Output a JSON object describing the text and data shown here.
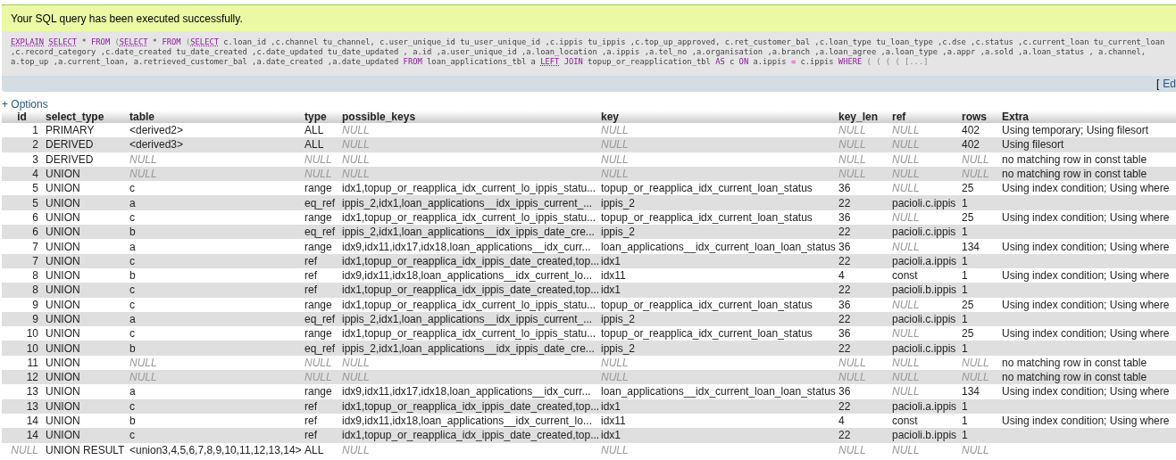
{
  "message": "Your SQL query has been executed successfully.",
  "sql_lines": [
    [
      {
        "kind": "func",
        "text": "EXPLAIN"
      },
      {
        "kind": "func",
        "text": "SELECT"
      },
      {
        "kind": "plain",
        "text": " * "
      },
      {
        "kind": "keyword",
        "text": "FROM"
      },
      {
        "kind": "punct",
        "text": " ("
      },
      {
        "kind": "func",
        "text": "SELECT"
      },
      {
        "kind": "plain",
        "text": " * "
      },
      {
        "kind": "keyword",
        "text": "FROM"
      },
      {
        "kind": "punct",
        "text": " ("
      },
      {
        "kind": "func",
        "text": "SELECT"
      },
      {
        "kind": "plain",
        "text": " c.loan_id ,c.channel tu_channel, c.user_unique_id tu_user_unique_id ,c.ippis tu_ippis ,c.top_up_approved, c.ret_customer_bal ,c.loan_type tu_loan_type ,c.dse ,c.status ,c.current_loan tu_current_loan"
      }
    ],
    [
      {
        "kind": "plain",
        "text": ",c.record_category ,c.date_created tu_date_created ,c.date_updated tu_date_updated , a.id ,a.user_unique_id ,a.loan_location ,a.ippis ,a.tel_no ,a.organisation ,a.branch ,a.loan_agree ,a.loan_type ,a.appr ,a.sold ,a.loan_status , a.channel,"
      }
    ],
    [
      {
        "kind": "plain",
        "text": "a.top_up ,a.current_loan, a.retrieved_customer_bal ,a.date_created ,a.date_updated "
      },
      {
        "kind": "keyword",
        "text": "FROM"
      },
      {
        "kind": "plain",
        "text": " loan_applications_tbl a "
      },
      {
        "kind": "func",
        "text": "LEFT"
      },
      {
        "kind": "keyword",
        "text": "JOIN"
      },
      {
        "kind": "plain",
        "text": " topup_or_reapplication_tbl "
      },
      {
        "kind": "keyword",
        "text": "AS"
      },
      {
        "kind": "plain",
        "text": " c "
      },
      {
        "kind": "keyword",
        "text": "ON"
      },
      {
        "kind": "plain",
        "text": " a.ippis "
      },
      {
        "kind": "operator",
        "text": "="
      },
      {
        "kind": "plain",
        "text": " c.ippis "
      },
      {
        "kind": "keyword",
        "text": "WHERE"
      },
      {
        "kind": "punct",
        "text": " ( ( ( ( [...]"
      }
    ]
  ],
  "edit_bracket": "[",
  "edit_link": "Ed",
  "options_link": "+ Options",
  "table": {
    "columns": [
      "id",
      "select_type",
      "table",
      "type",
      "possible_keys",
      "key",
      "key_len",
      "ref",
      "rows",
      "Extra"
    ],
    "rows": [
      [
        "1",
        "PRIMARY",
        "<derived2>",
        "ALL",
        {
          "kind": "null",
          "text": "NULL"
        },
        {
          "kind": "null",
          "text": "NULL"
        },
        {
          "kind": "null",
          "text": "NULL"
        },
        {
          "kind": "null",
          "text": "NULL"
        },
        "402",
        "Using temporary; Using filesort"
      ],
      [
        "2",
        "DERIVED",
        "<derived3>",
        "ALL",
        {
          "kind": "null",
          "text": "NULL"
        },
        {
          "kind": "null",
          "text": "NULL"
        },
        {
          "kind": "null",
          "text": "NULL"
        },
        {
          "kind": "null",
          "text": "NULL"
        },
        "402",
        "Using filesort"
      ],
      [
        "3",
        "DERIVED",
        {
          "kind": "null",
          "text": "NULL"
        },
        {
          "kind": "null",
          "text": "NULL"
        },
        {
          "kind": "null",
          "text": "NULL"
        },
        {
          "kind": "null",
          "text": "NULL"
        },
        {
          "kind": "null",
          "text": "NULL"
        },
        {
          "kind": "null",
          "text": "NULL"
        },
        {
          "kind": "null",
          "text": "NULL"
        },
        "no matching row in const table"
      ],
      [
        "4",
        "UNION",
        {
          "kind": "null",
          "text": "NULL"
        },
        {
          "kind": "null",
          "text": "NULL"
        },
        {
          "kind": "null",
          "text": "NULL"
        },
        {
          "kind": "null",
          "text": "NULL"
        },
        {
          "kind": "null",
          "text": "NULL"
        },
        {
          "kind": "null",
          "text": "NULL"
        },
        {
          "kind": "null",
          "text": "NULL"
        },
        "no matching row in const table"
      ],
      [
        "5",
        "UNION",
        "c",
        "range",
        "idx1,topup_or_reapplica_idx_current_lo_ippis_statu...",
        "topup_or_reapplica_idx_current_loan_status",
        "36",
        {
          "kind": "null",
          "text": "NULL"
        },
        "25",
        "Using index condition; Using where"
      ],
      [
        "5",
        "UNION",
        "a",
        "eq_ref",
        "ippis_2,idx1,loan_applications__idx_ippis_current_...",
        "ippis_2",
        "22",
        "pacioli.c.ippis",
        "1",
        ""
      ],
      [
        "6",
        "UNION",
        "c",
        "range",
        "idx1,topup_or_reapplica_idx_current_lo_ippis_statu...",
        "topup_or_reapplica_idx_current_loan_status",
        "36",
        {
          "kind": "null",
          "text": "NULL"
        },
        "25",
        "Using index condition; Using where"
      ],
      [
        "6",
        "UNION",
        "b",
        "eq_ref",
        "ippis_2,idx1,loan_applications__idx_ippis_date_cre...",
        "ippis_2",
        "22",
        "pacioli.c.ippis",
        "1",
        ""
      ],
      [
        "7",
        "UNION",
        "a",
        "range",
        "idx9,idx11,idx17,idx18,loan_applications__idx_curr...",
        "loan_applications__idx_current_loan_loan_status",
        "36",
        {
          "kind": "null",
          "text": "NULL"
        },
        "134",
        "Using index condition; Using where"
      ],
      [
        "7",
        "UNION",
        "c",
        "ref",
        "idx1,topup_or_reapplica_idx_ippis_date_created,top...",
        "idx1",
        "22",
        "pacioli.a.ippis",
        "1",
        ""
      ],
      [
        "8",
        "UNION",
        "b",
        "ref",
        "idx9,idx11,idx18,loan_applications__idx_current_lo...",
        "idx11",
        "4",
        "const",
        "1",
        "Using index condition; Using where"
      ],
      [
        "8",
        "UNION",
        "c",
        "ref",
        "idx1,topup_or_reapplica_idx_ippis_date_created,top...",
        "idx1",
        "22",
        "pacioli.b.ippis",
        "1",
        ""
      ],
      [
        "9",
        "UNION",
        "c",
        "range",
        "idx1,topup_or_reapplica_idx_current_lo_ippis_statu...",
        "topup_or_reapplica_idx_current_loan_status",
        "36",
        {
          "kind": "null",
          "text": "NULL"
        },
        "25",
        "Using index condition; Using where"
      ],
      [
        "9",
        "UNION",
        "a",
        "eq_ref",
        "ippis_2,idx1,loan_applications__idx_ippis_current_...",
        "ippis_2",
        "22",
        "pacioli.c.ippis",
        "1",
        ""
      ],
      [
        "10",
        "UNION",
        "c",
        "range",
        "idx1,topup_or_reapplica_idx_current_lo_ippis_statu...",
        "topup_or_reapplica_idx_current_loan_status",
        "36",
        {
          "kind": "null",
          "text": "NULL"
        },
        "25",
        "Using index condition; Using where"
      ],
      [
        "10",
        "UNION",
        "b",
        "eq_ref",
        "ippis_2,idx1,loan_applications__idx_ippis_date_cre...",
        "ippis_2",
        "22",
        "pacioli.c.ippis",
        "1",
        ""
      ],
      [
        "11",
        "UNION",
        {
          "kind": "null",
          "text": "NULL"
        },
        {
          "kind": "null",
          "text": "NULL"
        },
        {
          "kind": "null",
          "text": "NULL"
        },
        {
          "kind": "null",
          "text": "NULL"
        },
        {
          "kind": "null",
          "text": "NULL"
        },
        {
          "kind": "null",
          "text": "NULL"
        },
        {
          "kind": "null",
          "text": "NULL"
        },
        "no matching row in const table"
      ],
      [
        "12",
        "UNION",
        {
          "kind": "null",
          "text": "NULL"
        },
        {
          "kind": "null",
          "text": "NULL"
        },
        {
          "kind": "null",
          "text": "NULL"
        },
        {
          "kind": "null",
          "text": "NULL"
        },
        {
          "kind": "null",
          "text": "NULL"
        },
        {
          "kind": "null",
          "text": "NULL"
        },
        {
          "kind": "null",
          "text": "NULL"
        },
        "no matching row in const table"
      ],
      [
        "13",
        "UNION",
        "a",
        "range",
        "idx9,idx11,idx17,idx18,loan_applications__idx_curr...",
        "loan_applications__idx_current_loan_loan_status",
        "36",
        {
          "kind": "null",
          "text": "NULL"
        },
        "134",
        "Using index condition; Using where"
      ],
      [
        "13",
        "UNION",
        "c",
        "ref",
        "idx1,topup_or_reapplica_idx_ippis_date_created,top...",
        "idx1",
        "22",
        "pacioli.a.ippis",
        "1",
        ""
      ],
      [
        "14",
        "UNION",
        "b",
        "ref",
        "idx9,idx11,idx18,loan_applications__idx_current_lo...",
        "idx11",
        "4",
        "const",
        "1",
        "Using index condition; Using where"
      ],
      [
        "14",
        "UNION",
        "c",
        "ref",
        "idx1,topup_or_reapplica_idx_ippis_date_created,top...",
        "idx1",
        "22",
        "pacioli.b.ippis",
        "1",
        ""
      ],
      [
        {
          "kind": "null",
          "text": "NULL"
        },
        "UNION RESULT",
        "<union3,4,5,6,7,8,9,10,11,12,13,14>",
        "ALL",
        {
          "kind": "null",
          "text": "NULL"
        },
        {
          "kind": "null",
          "text": "NULL"
        },
        {
          "kind": "null",
          "text": "NULL"
        },
        {
          "kind": "null",
          "text": "NULL"
        },
        {
          "kind": "null",
          "text": "NULL"
        },
        ""
      ]
    ]
  }
}
